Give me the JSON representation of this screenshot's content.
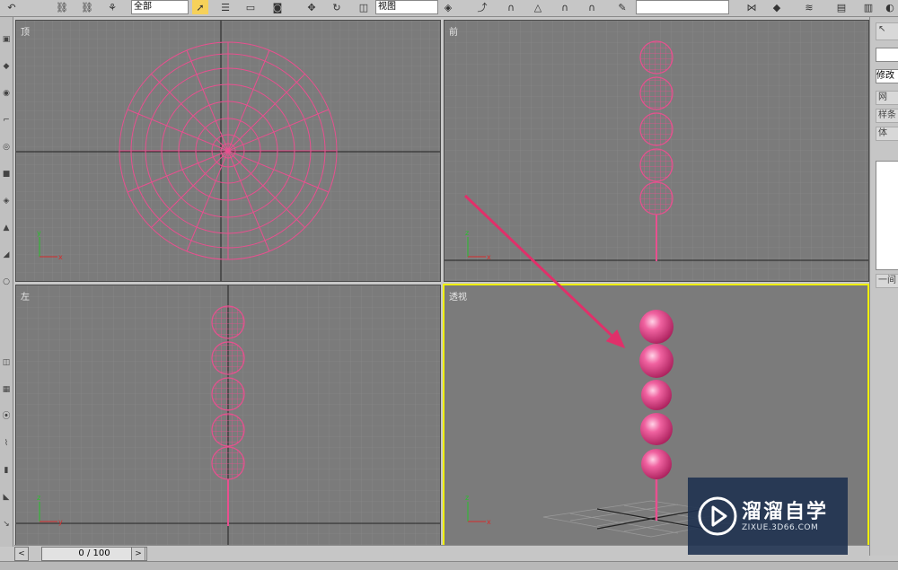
{
  "toolbar": {
    "selection_filter": "全部",
    "reference_coord": "视图"
  },
  "viewports": {
    "top": {
      "label": "顶"
    },
    "front": {
      "label": "前"
    },
    "left": {
      "label": "左"
    },
    "perspective": {
      "label": "透视",
      "active": true
    }
  },
  "command_panel": {
    "modifier_list": "修改",
    "buttons": [
      "网",
      "样条",
      "体"
    ],
    "label": "一间"
  },
  "timeline": {
    "frame_counter": "0 / 100",
    "prev": "<",
    "next": ">"
  },
  "watermark": {
    "brand": "溜溜自学",
    "url": "ZIXUE.3D66.COM"
  },
  "colors": {
    "object": "#e8508f",
    "grid": "#8c8c8c",
    "viewport_bg": "#7b7b7b",
    "active_border": "#f0f000",
    "arrow": "#e0306a"
  }
}
